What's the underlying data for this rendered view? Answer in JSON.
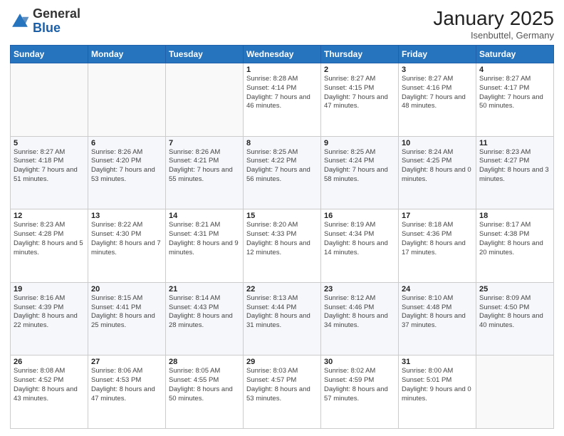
{
  "header": {
    "logo_general": "General",
    "logo_blue": "Blue",
    "month_year": "January 2025",
    "location": "Isenbuttel, Germany"
  },
  "weekdays": [
    "Sunday",
    "Monday",
    "Tuesday",
    "Wednesday",
    "Thursday",
    "Friday",
    "Saturday"
  ],
  "weeks": [
    [
      {
        "day": "",
        "sunrise": "",
        "sunset": "",
        "daylight": ""
      },
      {
        "day": "",
        "sunrise": "",
        "sunset": "",
        "daylight": ""
      },
      {
        "day": "",
        "sunrise": "",
        "sunset": "",
        "daylight": ""
      },
      {
        "day": "1",
        "sunrise": "Sunrise: 8:28 AM",
        "sunset": "Sunset: 4:14 PM",
        "daylight": "Daylight: 7 hours and 46 minutes."
      },
      {
        "day": "2",
        "sunrise": "Sunrise: 8:27 AM",
        "sunset": "Sunset: 4:15 PM",
        "daylight": "Daylight: 7 hours and 47 minutes."
      },
      {
        "day": "3",
        "sunrise": "Sunrise: 8:27 AM",
        "sunset": "Sunset: 4:16 PM",
        "daylight": "Daylight: 7 hours and 48 minutes."
      },
      {
        "day": "4",
        "sunrise": "Sunrise: 8:27 AM",
        "sunset": "Sunset: 4:17 PM",
        "daylight": "Daylight: 7 hours and 50 minutes."
      }
    ],
    [
      {
        "day": "5",
        "sunrise": "Sunrise: 8:27 AM",
        "sunset": "Sunset: 4:18 PM",
        "daylight": "Daylight: 7 hours and 51 minutes."
      },
      {
        "day": "6",
        "sunrise": "Sunrise: 8:26 AM",
        "sunset": "Sunset: 4:20 PM",
        "daylight": "Daylight: 7 hours and 53 minutes."
      },
      {
        "day": "7",
        "sunrise": "Sunrise: 8:26 AM",
        "sunset": "Sunset: 4:21 PM",
        "daylight": "Daylight: 7 hours and 55 minutes."
      },
      {
        "day": "8",
        "sunrise": "Sunrise: 8:25 AM",
        "sunset": "Sunset: 4:22 PM",
        "daylight": "Daylight: 7 hours and 56 minutes."
      },
      {
        "day": "9",
        "sunrise": "Sunrise: 8:25 AM",
        "sunset": "Sunset: 4:24 PM",
        "daylight": "Daylight: 7 hours and 58 minutes."
      },
      {
        "day": "10",
        "sunrise": "Sunrise: 8:24 AM",
        "sunset": "Sunset: 4:25 PM",
        "daylight": "Daylight: 8 hours and 0 minutes."
      },
      {
        "day": "11",
        "sunrise": "Sunrise: 8:23 AM",
        "sunset": "Sunset: 4:27 PM",
        "daylight": "Daylight: 8 hours and 3 minutes."
      }
    ],
    [
      {
        "day": "12",
        "sunrise": "Sunrise: 8:23 AM",
        "sunset": "Sunset: 4:28 PM",
        "daylight": "Daylight: 8 hours and 5 minutes."
      },
      {
        "day": "13",
        "sunrise": "Sunrise: 8:22 AM",
        "sunset": "Sunset: 4:30 PM",
        "daylight": "Daylight: 8 hours and 7 minutes."
      },
      {
        "day": "14",
        "sunrise": "Sunrise: 8:21 AM",
        "sunset": "Sunset: 4:31 PM",
        "daylight": "Daylight: 8 hours and 9 minutes."
      },
      {
        "day": "15",
        "sunrise": "Sunrise: 8:20 AM",
        "sunset": "Sunset: 4:33 PM",
        "daylight": "Daylight: 8 hours and 12 minutes."
      },
      {
        "day": "16",
        "sunrise": "Sunrise: 8:19 AM",
        "sunset": "Sunset: 4:34 PM",
        "daylight": "Daylight: 8 hours and 14 minutes."
      },
      {
        "day": "17",
        "sunrise": "Sunrise: 8:18 AM",
        "sunset": "Sunset: 4:36 PM",
        "daylight": "Daylight: 8 hours and 17 minutes."
      },
      {
        "day": "18",
        "sunrise": "Sunrise: 8:17 AM",
        "sunset": "Sunset: 4:38 PM",
        "daylight": "Daylight: 8 hours and 20 minutes."
      }
    ],
    [
      {
        "day": "19",
        "sunrise": "Sunrise: 8:16 AM",
        "sunset": "Sunset: 4:39 PM",
        "daylight": "Daylight: 8 hours and 22 minutes."
      },
      {
        "day": "20",
        "sunrise": "Sunrise: 8:15 AM",
        "sunset": "Sunset: 4:41 PM",
        "daylight": "Daylight: 8 hours and 25 minutes."
      },
      {
        "day": "21",
        "sunrise": "Sunrise: 8:14 AM",
        "sunset": "Sunset: 4:43 PM",
        "daylight": "Daylight: 8 hours and 28 minutes."
      },
      {
        "day": "22",
        "sunrise": "Sunrise: 8:13 AM",
        "sunset": "Sunset: 4:44 PM",
        "daylight": "Daylight: 8 hours and 31 minutes."
      },
      {
        "day": "23",
        "sunrise": "Sunrise: 8:12 AM",
        "sunset": "Sunset: 4:46 PM",
        "daylight": "Daylight: 8 hours and 34 minutes."
      },
      {
        "day": "24",
        "sunrise": "Sunrise: 8:10 AM",
        "sunset": "Sunset: 4:48 PM",
        "daylight": "Daylight: 8 hours and 37 minutes."
      },
      {
        "day": "25",
        "sunrise": "Sunrise: 8:09 AM",
        "sunset": "Sunset: 4:50 PM",
        "daylight": "Daylight: 8 hours and 40 minutes."
      }
    ],
    [
      {
        "day": "26",
        "sunrise": "Sunrise: 8:08 AM",
        "sunset": "Sunset: 4:52 PM",
        "daylight": "Daylight: 8 hours and 43 minutes."
      },
      {
        "day": "27",
        "sunrise": "Sunrise: 8:06 AM",
        "sunset": "Sunset: 4:53 PM",
        "daylight": "Daylight: 8 hours and 47 minutes."
      },
      {
        "day": "28",
        "sunrise": "Sunrise: 8:05 AM",
        "sunset": "Sunset: 4:55 PM",
        "daylight": "Daylight: 8 hours and 50 minutes."
      },
      {
        "day": "29",
        "sunrise": "Sunrise: 8:03 AM",
        "sunset": "Sunset: 4:57 PM",
        "daylight": "Daylight: 8 hours and 53 minutes."
      },
      {
        "day": "30",
        "sunrise": "Sunrise: 8:02 AM",
        "sunset": "Sunset: 4:59 PM",
        "daylight": "Daylight: 8 hours and 57 minutes."
      },
      {
        "day": "31",
        "sunrise": "Sunrise: 8:00 AM",
        "sunset": "Sunset: 5:01 PM",
        "daylight": "Daylight: 9 hours and 0 minutes."
      },
      {
        "day": "",
        "sunrise": "",
        "sunset": "",
        "daylight": ""
      }
    ]
  ]
}
